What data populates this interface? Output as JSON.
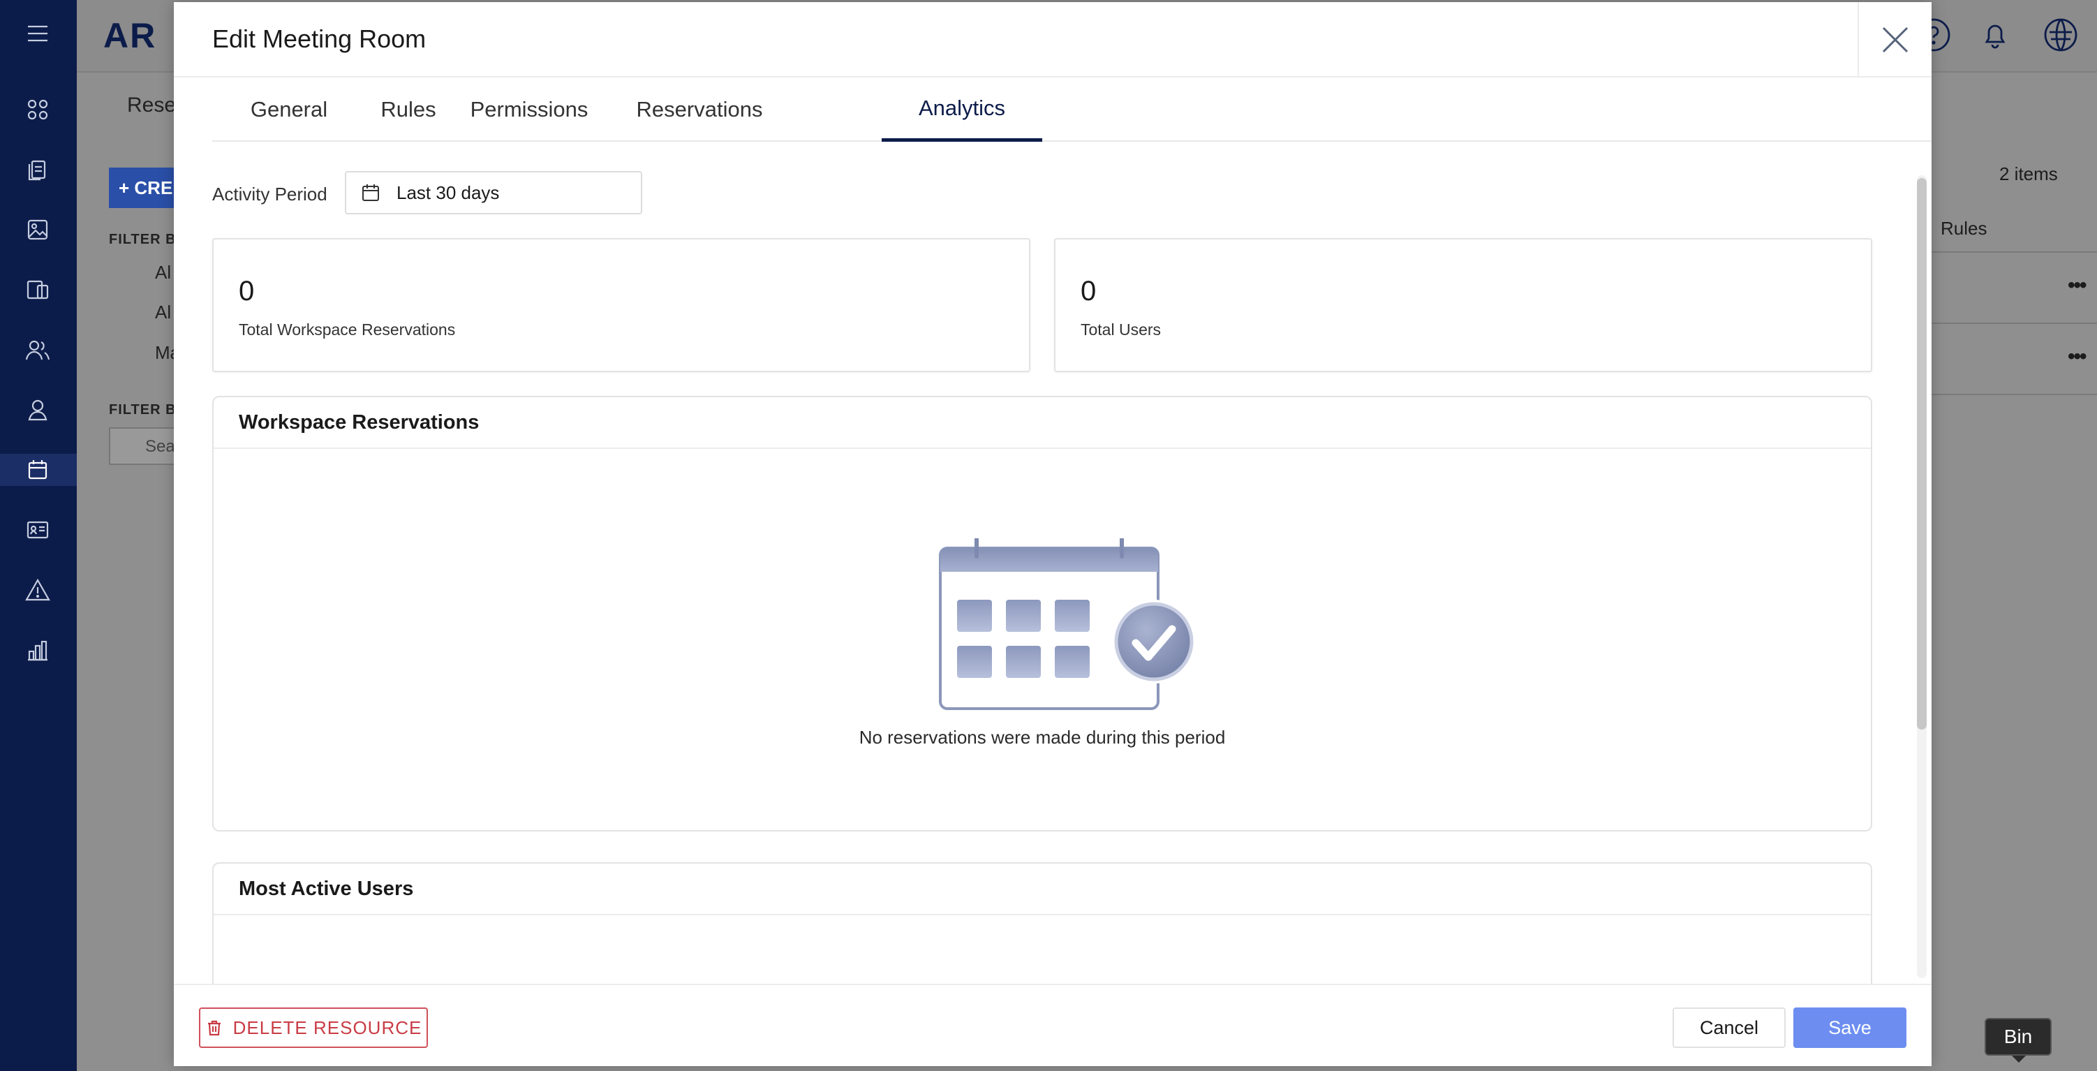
{
  "background": {
    "logo": "AR",
    "tab_label": "Rese",
    "create_button": "+ CRE",
    "filter_by_1": "FILTER BY",
    "filter_by_2": "FILTER BY",
    "filter_items": [
      "Al",
      "Al",
      "Ma"
    ],
    "search_placeholder": "Sea",
    "items_count": "2 items",
    "column_rules": "Rules",
    "row_actions": "•••"
  },
  "modal": {
    "title": "Edit Meeting Room",
    "tabs": [
      {
        "label": "General"
      },
      {
        "label": "Rules"
      },
      {
        "label": "Permissions"
      },
      {
        "label": "Reservations"
      },
      {
        "label": "Analytics"
      }
    ],
    "active_tab": "Analytics",
    "activity_period": {
      "label": "Activity Period",
      "value": "Last 30 days"
    },
    "stats": [
      {
        "value": "0",
        "label": "Total Workspace Reservations"
      },
      {
        "value": "0",
        "label": "Total Users"
      }
    ],
    "workspace_reservations": {
      "title": "Workspace Reservations",
      "empty_text": "No reservations were made during this period"
    },
    "most_active_users": {
      "title": "Most Active Users"
    },
    "footer": {
      "delete_label": "DELETE RESOURCE",
      "cancel_label": "Cancel",
      "save_label": "Save"
    }
  },
  "tooltip": "Bin",
  "colors": {
    "sidebar": "#0c1c4a",
    "accent": "#0c1c4a",
    "save": "#6d8ef0",
    "danger": "#c93c45"
  }
}
